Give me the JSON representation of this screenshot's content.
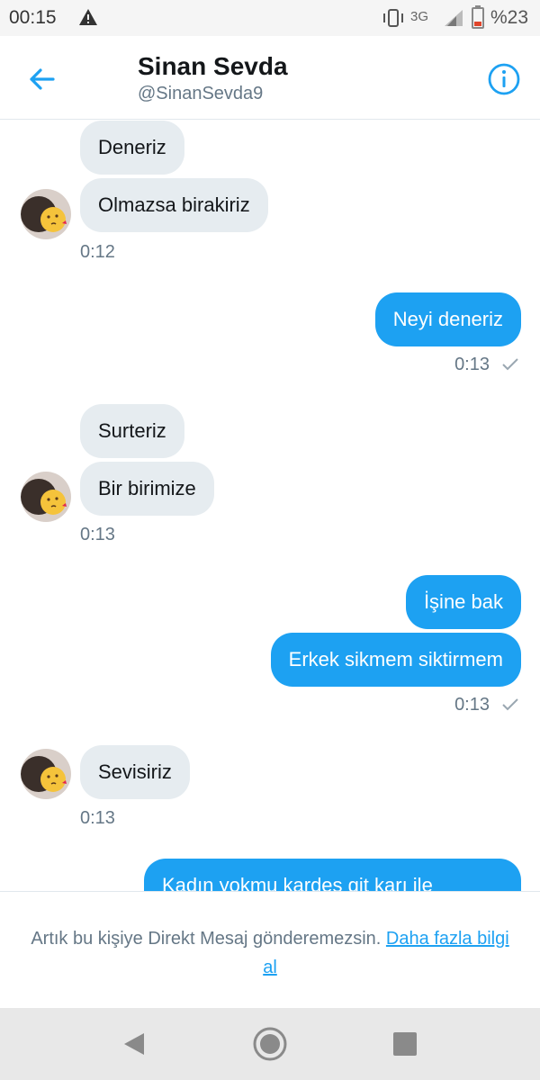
{
  "status_bar": {
    "time": "00:15",
    "network": "3G",
    "battery": "%23",
    "icons": [
      "warning-icon",
      "vibrate-icon",
      "signal-icon",
      "battery-icon"
    ]
  },
  "header": {
    "name": "Sinan Sevda",
    "handle": "@SinanSevda9",
    "icons": [
      "back-arrow-icon",
      "info-icon"
    ]
  },
  "messages": [
    {
      "dir": "in",
      "text": "Deneriz"
    },
    {
      "dir": "in",
      "text": "Olmazsa birakiriz"
    },
    {
      "time": "0:12"
    },
    {
      "dir": "out",
      "text": "Neyi deneriz",
      "time": "0:13"
    },
    {
      "dir": "in",
      "text": "Surteriz"
    },
    {
      "dir": "in",
      "text": "Bir birimize",
      "time": "0:13"
    },
    {
      "dir": "out",
      "text": "İşine bak"
    },
    {
      "dir": "out",
      "text": "Erkek sikmem siktirmem",
      "time": "0:13"
    },
    {
      "dir": "in",
      "text": "Sevisiriz",
      "time": "0:13"
    },
    {
      "dir": "out",
      "text": "Kadın yokmu kardes git karı ile"
    }
  ],
  "chat": {
    "in1a": "Deneriz",
    "in1b": "Olmazsa birakiriz",
    "in1_time": "0:12",
    "out1": "Neyi deneriz",
    "out1_time": "0:13",
    "in2a": "Surteriz",
    "in2b": "Bir birimize",
    "in2_time": "0:13",
    "out2a": "İşine bak",
    "out2b": "Erkek sikmem siktirmem",
    "out2_time": "0:13",
    "in3": "Sevisiriz",
    "in3_time": "0:13",
    "out3_partial": "Kadın yokmu kardes git karı ile"
  },
  "notice": {
    "text": "Artık bu kişiye Direkt Mesaj gönderemezsin.",
    "link": "Daha fazla bilgi al"
  },
  "colors": {
    "accent": "#1da1f2",
    "incoming_bubble": "#e6ecf0",
    "secondary_text": "#657786"
  },
  "nav": {
    "icons": [
      "nav-back-icon",
      "nav-home-icon",
      "nav-recents-icon"
    ]
  }
}
